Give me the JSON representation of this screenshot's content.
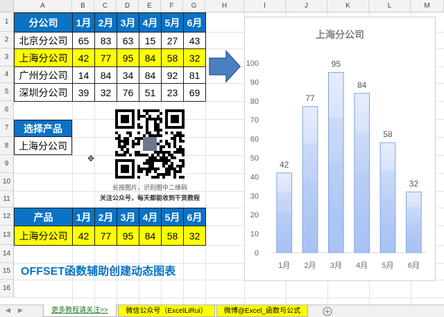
{
  "columns": [
    "A",
    "B",
    "C",
    "D",
    "E",
    "F",
    "G",
    "H",
    "I",
    "J",
    "K",
    "L",
    "M"
  ],
  "rows": [
    "1",
    "2",
    "3",
    "4",
    "5",
    "6",
    "7",
    "8",
    "9",
    "10",
    "11",
    "12",
    "13",
    "14",
    "15",
    "16"
  ],
  "table1": {
    "header": [
      "分公司",
      "1月",
      "2月",
      "3月",
      "4月",
      "5月",
      "6月"
    ],
    "rows": [
      [
        "北京分公司",
        "65",
        "83",
        "63",
        "15",
        "27",
        "43"
      ],
      [
        "上海分公司",
        "42",
        "77",
        "95",
        "84",
        "58",
        "32"
      ],
      [
        "广州分公司",
        "14",
        "84",
        "34",
        "84",
        "92",
        "81"
      ],
      [
        "深圳分公司",
        "39",
        "32",
        "76",
        "51",
        "23",
        "69"
      ]
    ]
  },
  "selector": {
    "label": "选择产品",
    "value": "上海分公司"
  },
  "qr_caption": {
    "line1": "长按图片，识别图中二维码",
    "line2": "关注公众号，每天都能收到干货教程"
  },
  "table2": {
    "header": [
      "产品",
      "1月",
      "2月",
      "3月",
      "4月",
      "5月",
      "6月"
    ],
    "row": [
      "上海分公司",
      "42",
      "77",
      "95",
      "84",
      "58",
      "32"
    ]
  },
  "footer_title": "OFFSET函数辅助创建动态图表",
  "chart_data": {
    "type": "bar",
    "title": "上海分公司",
    "categories": [
      "1月",
      "2月",
      "3月",
      "4月",
      "5月",
      "6月"
    ],
    "values": [
      42,
      77,
      95,
      84,
      58,
      32
    ],
    "yticks": [
      "0",
      "10",
      "20",
      "30",
      "40",
      "50",
      "60",
      "70",
      "80",
      "90",
      "100"
    ],
    "ylim": [
      0,
      100
    ],
    "grid": false,
    "data_labels": true,
    "bar_color": "#b9cdf7"
  },
  "tabs": [
    {
      "label": "更多教程请关注>>",
      "color": "#ffffff",
      "active": true
    },
    {
      "label": "微信公众号（ExcelLiRui）",
      "color": "#ffff00",
      "active": false
    },
    {
      "label": "微博@Excel_函数与公式",
      "color": "#ffff00",
      "active": false
    }
  ],
  "add_sheet_icon": "plus-circle-icon",
  "colors": {
    "header_blue": "#0a73c6",
    "highlight_yellow": "#ffff00",
    "arrow_blue": "#4a7fc1"
  }
}
